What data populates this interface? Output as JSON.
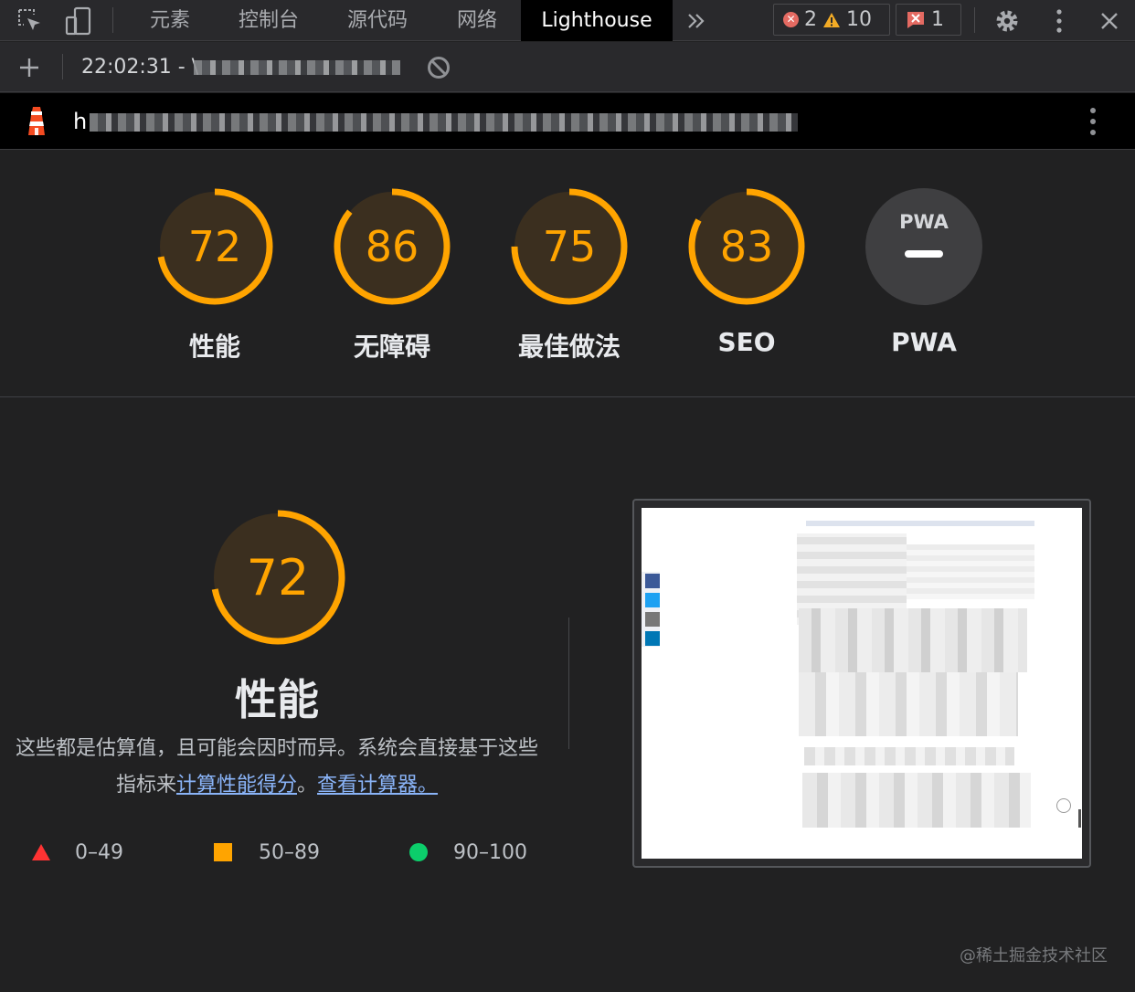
{
  "tabbar": {
    "tabs": [
      "元素",
      "控制台",
      "源代码",
      "网络",
      "Lighthouse"
    ],
    "active_tab": "Lighthouse",
    "error_count": "2",
    "warning_count": "10",
    "issue_count": "1"
  },
  "report": {
    "time_prefix": "22:02:31 - \\",
    "url_prefix": "h"
  },
  "categories": [
    {
      "score": "72",
      "label": "性能",
      "value": 0.72
    },
    {
      "score": "86",
      "label": "无障碍",
      "value": 0.86
    },
    {
      "score": "75",
      "label": "最佳做法",
      "value": 0.75
    },
    {
      "score": "83",
      "label": "SEO",
      "value": 0.83
    },
    {
      "score": "",
      "label": "PWA",
      "badge": "PWA"
    }
  ],
  "performance": {
    "score": "72",
    "value": 0.72,
    "title": "性能",
    "desc_prefix": "这些都是估算值，且可能会因时而异。系统会直接基于这些指标来",
    "link1": "计算性能得分",
    "desc_mid": "。",
    "link2": "查看计算器。"
  },
  "legend": [
    {
      "range": "0–49",
      "shape": "triangle",
      "color": "#ff3333"
    },
    {
      "range": "50–89",
      "shape": "square",
      "color": "#ffa400"
    },
    {
      "range": "90–100",
      "shape": "circle",
      "color": "#0cce6b"
    }
  ],
  "colors": {
    "average": "#ffa400",
    "average_bg": "#3b2f1f",
    "accent_link": "#8ab4f8"
  },
  "watermark": "@稀土掘金技术社区"
}
